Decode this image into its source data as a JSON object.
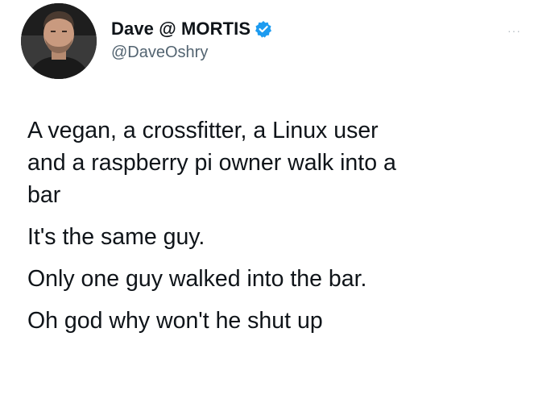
{
  "tweet": {
    "author": {
      "display_name": "Dave @ MORTIS",
      "handle": "@DaveOshry",
      "verified_icon": "verified-badge-icon",
      "avatar_icon": "avatar"
    },
    "menu_icon": "more-icon",
    "menu_glyph": "···",
    "paragraphs": [
      "A vegan, a crossfitter, a Linux user\nand a raspberry pi owner walk into a\nbar",
      "It's the same guy.",
      "Only one guy walked into the bar.",
      "Oh god why won't he shut up"
    ]
  },
  "colors": {
    "text": "#0f1419",
    "secondary": "#536471",
    "verified": "#1d9bf0"
  }
}
